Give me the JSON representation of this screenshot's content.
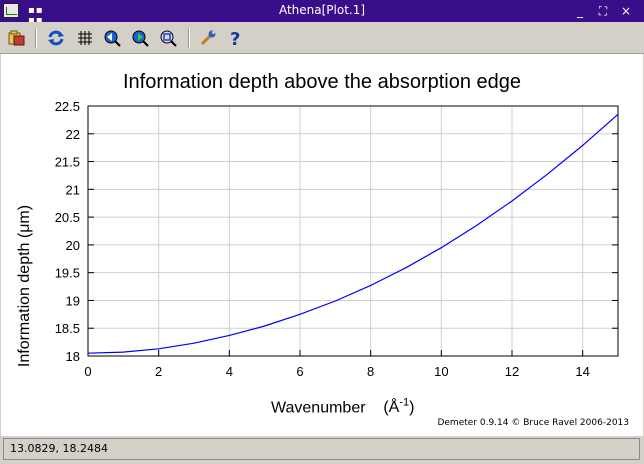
{
  "window": {
    "title": "Athena[Plot.1]",
    "minimize": "_",
    "maximize": "⛶",
    "close": "×"
  },
  "toolbar": {
    "icons": [
      "open-file-icon",
      "refresh-icon",
      "grid-icon",
      "zoom-previous-icon",
      "zoom-in-icon",
      "zoom-out-icon",
      "settings-wrench-icon",
      "help-icon"
    ]
  },
  "chart_data": {
    "type": "line",
    "title": "Information depth above the absorption edge",
    "xlabel": "Wavenumber",
    "xlabel_unit_base": "(Å",
    "xlabel_unit_exp": "-1",
    "xlabel_unit_close": ")",
    "ylabel": "Information depth  (μm)",
    "xlim": [
      0,
      15
    ],
    "ylim": [
      18,
      22.5
    ],
    "xticks": [
      "0",
      "2",
      "4",
      "6",
      "8",
      "10",
      "12",
      "14"
    ],
    "yticks": [
      "18",
      "18.5",
      "19",
      "19.5",
      "20",
      "20.5",
      "21",
      "21.5",
      "22",
      "22.5"
    ],
    "grid": true,
    "series": [
      {
        "color": "#0000ff",
        "x": [
          0,
          1,
          2,
          3,
          4,
          5,
          6,
          7,
          8,
          9,
          10,
          11,
          12,
          13,
          14,
          15
        ],
        "y": [
          18.05,
          18.07,
          18.13,
          18.23,
          18.37,
          18.54,
          18.75,
          18.99,
          19.27,
          19.59,
          19.95,
          20.35,
          20.79,
          21.27,
          21.79,
          22.35
        ]
      }
    ]
  },
  "credit": "Demeter 0.9.14 © Bruce Ravel 2006-2013",
  "status": {
    "text": "13.0829, 18.2484"
  }
}
